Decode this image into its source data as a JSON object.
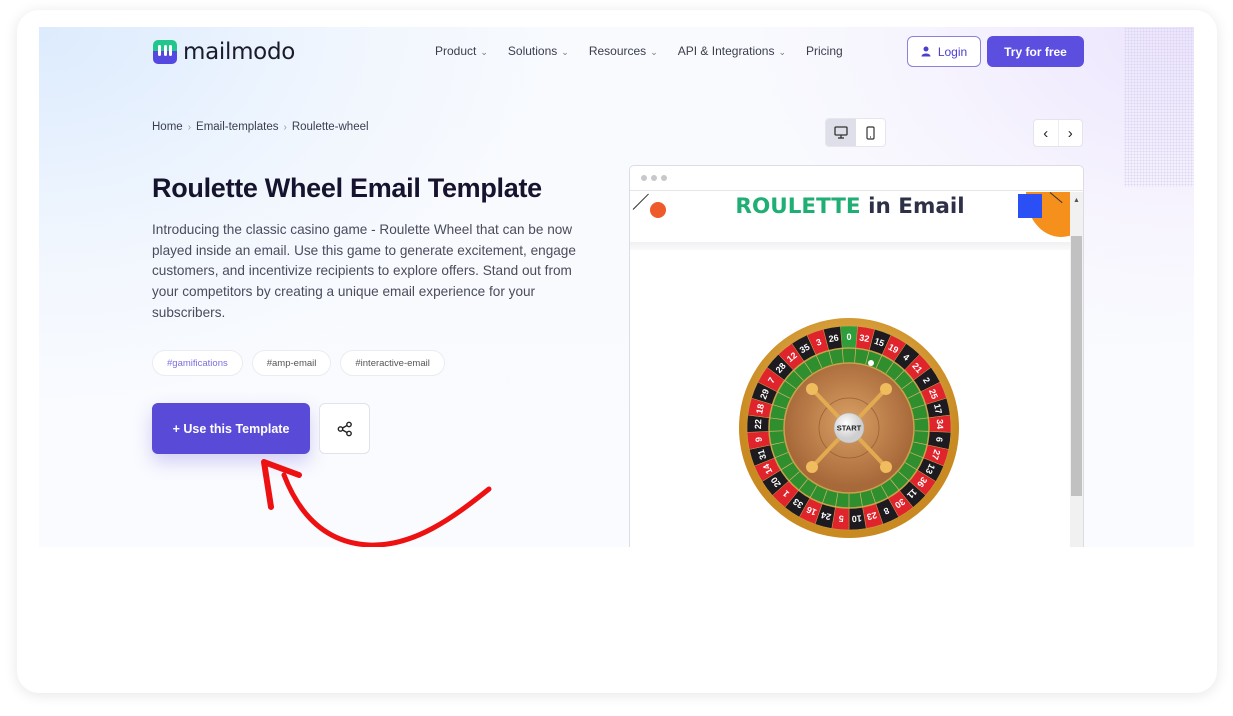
{
  "brand": {
    "name": "mailmodo",
    "accent": "#5c4fe0",
    "logo_green": "#22c58b"
  },
  "nav": {
    "items": [
      {
        "label": "Product",
        "has_dropdown": true
      },
      {
        "label": "Solutions",
        "has_dropdown": true
      },
      {
        "label": "Resources",
        "has_dropdown": true
      },
      {
        "label": "API & Integrations",
        "has_dropdown": true
      },
      {
        "label": "Pricing",
        "has_dropdown": false
      }
    ],
    "login_label": "Login",
    "try_label": "Try for free"
  },
  "breadcrumb": [
    "Home",
    "Email-templates",
    "Roulette-wheel"
  ],
  "page": {
    "title": "Roulette Wheel Email Template",
    "description": "Introducing the classic casino game - Roulette Wheel that can be now played inside an email. Use this game to generate excitement, engage customers, and incentivize recipients to explore offers. Stand out from your competitors by creating a unique email experience for your subscribers.",
    "tags": [
      "#gamifications",
      "#amp-email",
      "#interactive-email"
    ],
    "use_template_label": "+ Use this Template",
    "annotation_color": "#ee1111"
  },
  "preview": {
    "device_modes": [
      "desktop",
      "mobile"
    ],
    "active_device": "desktop",
    "prev_label": "‹",
    "next_label": "›",
    "email_title_highlight": "ROULETTE",
    "email_title_rest": " in Email",
    "start_label": "START",
    "wheel_numbers": [
      "0",
      "32",
      "15",
      "19",
      "4",
      "21",
      "2",
      "25",
      "17",
      "34",
      "6",
      "27",
      "13",
      "36",
      "11",
      "30",
      "8",
      "23",
      "10",
      "5",
      "24",
      "16",
      "33",
      "1",
      "20",
      "14",
      "31",
      "9",
      "22",
      "18",
      "29",
      "7",
      "28",
      "12",
      "35",
      "3",
      "26"
    ]
  }
}
